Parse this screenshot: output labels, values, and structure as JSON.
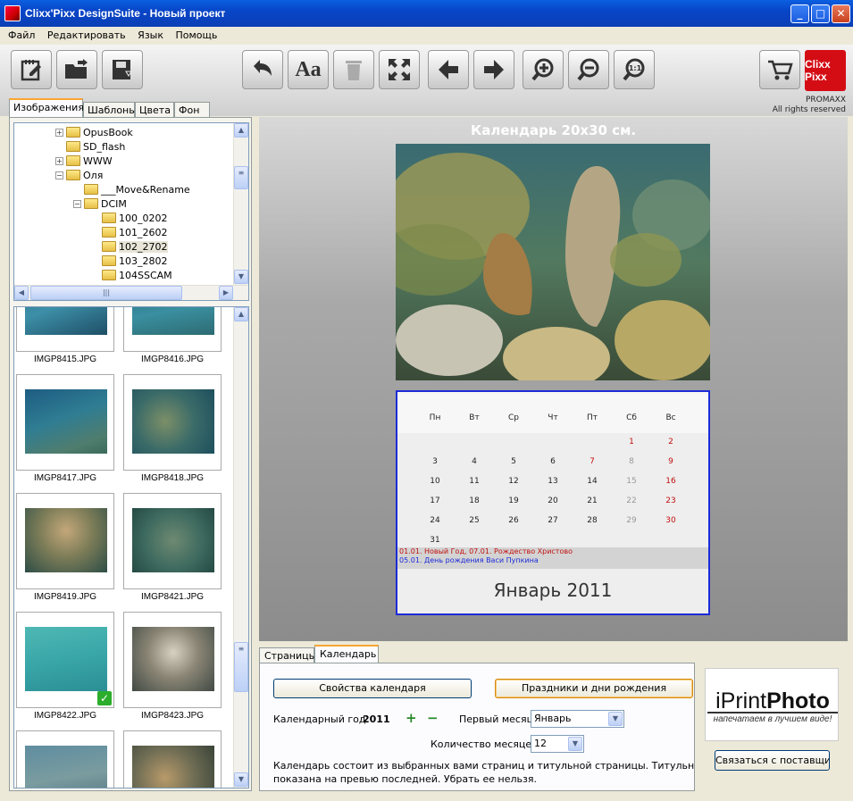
{
  "window": {
    "title": "Clixx'Pixx DesignSuite - Новый проект",
    "minimize": "_",
    "maximize": "□",
    "close": "✕"
  },
  "menu": [
    "Файл",
    "Редактировать",
    "Язык",
    "Помощь"
  ],
  "toolbar": {
    "logo_text": "Clixx Pixx",
    "brand": "PROMAXX",
    "rights": "All rights reserved"
  },
  "left_tabs": [
    "Изображения",
    "Шаблоны",
    "Цвета",
    "Фон"
  ],
  "tree": [
    {
      "label": "OpusBook",
      "expander": "+"
    },
    {
      "label": "SD_flash",
      "expander": ""
    },
    {
      "label": "WWW",
      "expander": "+"
    },
    {
      "label": "Оля",
      "expander": "−"
    },
    {
      "label": "___Move&Rename",
      "expander": ""
    },
    {
      "label": "DCIM",
      "expander": "−"
    },
    {
      "label": "100_0202",
      "expander": ""
    },
    {
      "label": "101_2602",
      "expander": ""
    },
    {
      "label": "102_2702",
      "expander": "",
      "selected": true
    },
    {
      "label": "103_2802",
      "expander": ""
    },
    {
      "label": "104SSCAM",
      "expander": ""
    }
  ],
  "thumbnails": [
    {
      "name": "IMGP8415.JPG"
    },
    {
      "name": "IMGP8416.JPG"
    },
    {
      "name": "IMGP8417.JPG"
    },
    {
      "name": "IMGP8418.JPG"
    },
    {
      "name": "IMGP8419.JPG"
    },
    {
      "name": "IMGP8421.JPG"
    },
    {
      "name": "IMGP8422.JPG",
      "checked": true
    },
    {
      "name": "IMGP8423.JPG"
    }
  ],
  "preview": {
    "title": "Календарь 20х30 см.",
    "weekdays": [
      "Пн",
      "Вт",
      "Ср",
      "Чт",
      "Пт",
      "Сб",
      "Вс"
    ],
    "holiday1": "01.01. Новый Год, 07.01. Рождество Христово",
    "holiday2": "05.01. День рождения Васи Пупкина",
    "month_title": "Январь 2011",
    "colors": {
      "red": "#c21010",
      "blue_note": "#1d2bd8",
      "border": "#1d2bd8"
    }
  },
  "calendar_days": [
    {
      "d": "1",
      "col": 5,
      "row": 0,
      "style": "red"
    },
    {
      "d": "2",
      "col": 6,
      "row": 0,
      "style": "red"
    },
    {
      "d": "3",
      "col": 0,
      "row": 1
    },
    {
      "d": "4",
      "col": 1,
      "row": 1
    },
    {
      "d": "5",
      "col": 2,
      "row": 1
    },
    {
      "d": "6",
      "col": 3,
      "row": 1
    },
    {
      "d": "7",
      "col": 4,
      "row": 1,
      "style": "red"
    },
    {
      "d": "8",
      "col": 5,
      "row": 1,
      "style": "grey"
    },
    {
      "d": "9",
      "col": 6,
      "row": 1,
      "style": "red"
    },
    {
      "d": "10",
      "col": 0,
      "row": 2
    },
    {
      "d": "11",
      "col": 1,
      "row": 2
    },
    {
      "d": "12",
      "col": 2,
      "row": 2
    },
    {
      "d": "13",
      "col": 3,
      "row": 2
    },
    {
      "d": "14",
      "col": 4,
      "row": 2
    },
    {
      "d": "15",
      "col": 5,
      "row": 2,
      "style": "grey"
    },
    {
      "d": "16",
      "col": 6,
      "row": 2,
      "style": "red"
    },
    {
      "d": "17",
      "col": 0,
      "row": 3
    },
    {
      "d": "18",
      "col": 1,
      "row": 3
    },
    {
      "d": "19",
      "col": 2,
      "row": 3
    },
    {
      "d": "20",
      "col": 3,
      "row": 3
    },
    {
      "d": "21",
      "col": 4,
      "row": 3
    },
    {
      "d": "22",
      "col": 5,
      "row": 3,
      "style": "grey"
    },
    {
      "d": "23",
      "col": 6,
      "row": 3,
      "style": "red"
    },
    {
      "d": "24",
      "col": 0,
      "row": 4
    },
    {
      "d": "25",
      "col": 1,
      "row": 4
    },
    {
      "d": "26",
      "col": 2,
      "row": 4
    },
    {
      "d": "27",
      "col": 3,
      "row": 4
    },
    {
      "d": "28",
      "col": 4,
      "row": 4
    },
    {
      "d": "29",
      "col": 5,
      "row": 4,
      "style": "grey"
    },
    {
      "d": "30",
      "col": 6,
      "row": 4,
      "style": "red"
    },
    {
      "d": "31",
      "col": 0,
      "row": 5
    }
  ],
  "bottom_tabs": [
    "Страницы",
    "Календарь"
  ],
  "calendar_settings": {
    "properties_button": "Свойства календаря",
    "holidays_button": "Праздники и дни рождения",
    "year_label": "Календарный год",
    "year_value": "2011",
    "plus": "+",
    "minus": "−",
    "first_month_label": "Первый месяц",
    "first_month_value": "Январь",
    "months_count_label": "Количество месяцев",
    "months_count_value": "12",
    "description_line1": "Календарь состоит из выбранных вами страниц и титульной страницы. Титульная страница",
    "description_line2": "показана на превью последней. Убрать ее нельзя."
  },
  "ad": {
    "brand_thin": "iPrint",
    "brand_bold": "Photo",
    "slogan": "напечатаем в лучшем виде!",
    "contact_button": "Связаться с поставщиком"
  }
}
